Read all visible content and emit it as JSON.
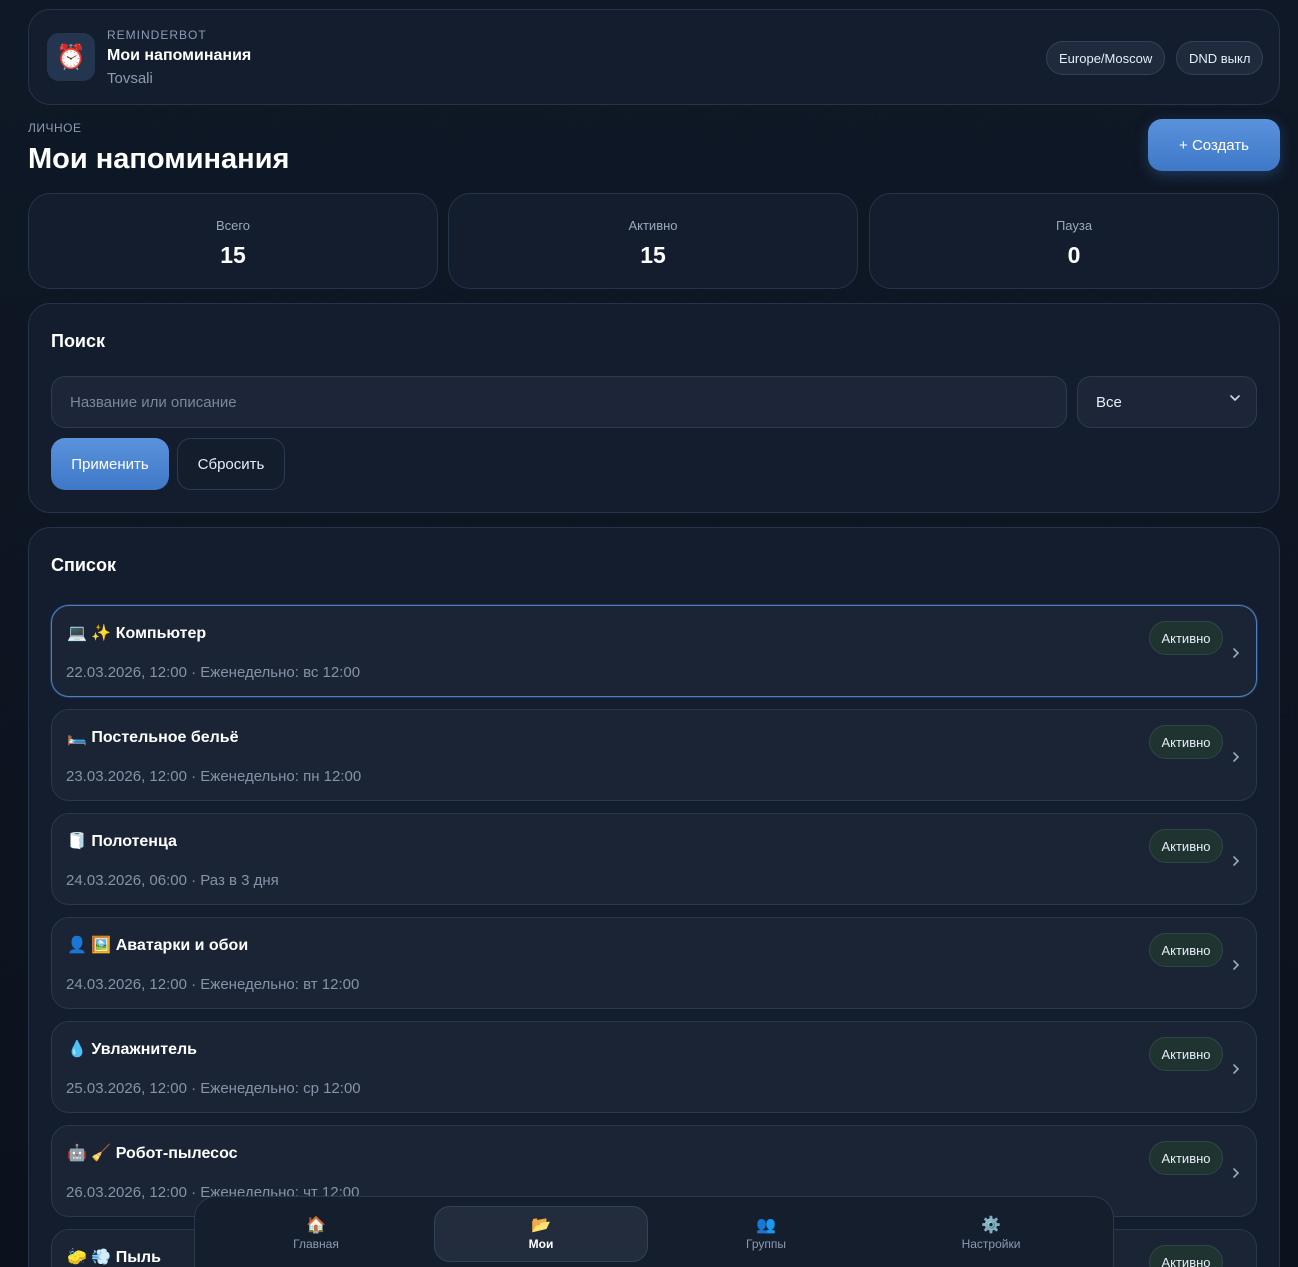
{
  "header": {
    "app_icon": "⏰",
    "brand": "REMINDERBOT",
    "title": "Мои напоминания",
    "user": "Tovsali",
    "timezone": "Europe/Moscow",
    "dnd": "DND выкл"
  },
  "page": {
    "eyebrow": "ЛИЧНОЕ",
    "title": "Мои напоминания",
    "create_label": "+ Создать"
  },
  "stats": [
    {
      "label": "Всего",
      "value": "15"
    },
    {
      "label": "Активно",
      "value": "15"
    },
    {
      "label": "Пауза",
      "value": "0"
    }
  ],
  "search": {
    "title": "Поиск",
    "placeholder": "Название или описание",
    "filter_value": "Все",
    "apply_label": "Применить",
    "reset_label": "Сбросить"
  },
  "list": {
    "title": "Список",
    "items": [
      {
        "title": "💻 ✨ Компьютер",
        "meta": "22.03.2026, 12:00 · Еженедельно: вс 12:00",
        "status": "Активно"
      },
      {
        "title": "🛏️ Постельное бельё",
        "meta": "23.03.2026, 12:00 · Еженедельно: пн 12:00",
        "status": "Активно"
      },
      {
        "title": "🧻 Полотенца",
        "meta": "24.03.2026, 06:00 · Раз в 3 дня",
        "status": "Активно"
      },
      {
        "title": "👤 🖼️ Аватарки и обои",
        "meta": "24.03.2026, 12:00 · Еженедельно: вт 12:00",
        "status": "Активно"
      },
      {
        "title": "💧 Увлажнитель",
        "meta": "25.03.2026, 12:00 · Еженедельно: ср 12:00",
        "status": "Активно"
      },
      {
        "title": "🤖 🧹 Робот-пылесос",
        "meta": "26.03.2026, 12:00 · Еженедельно: чт 12:00",
        "status": "Активно"
      },
      {
        "title": "🧽 💨 Пыль",
        "meta": "",
        "status": "Активно"
      }
    ]
  },
  "nav": [
    {
      "icon": "🏠",
      "label": "Главная"
    },
    {
      "icon": "📂",
      "label": "Мои"
    },
    {
      "icon": "👥",
      "label": "Группы"
    },
    {
      "icon": "⚙️",
      "label": "Настройки"
    }
  ],
  "colors": {
    "accent": "#4a86d4",
    "background": "#0f1826",
    "card": "#131d2e",
    "badge_bg": "#1f3331"
  }
}
